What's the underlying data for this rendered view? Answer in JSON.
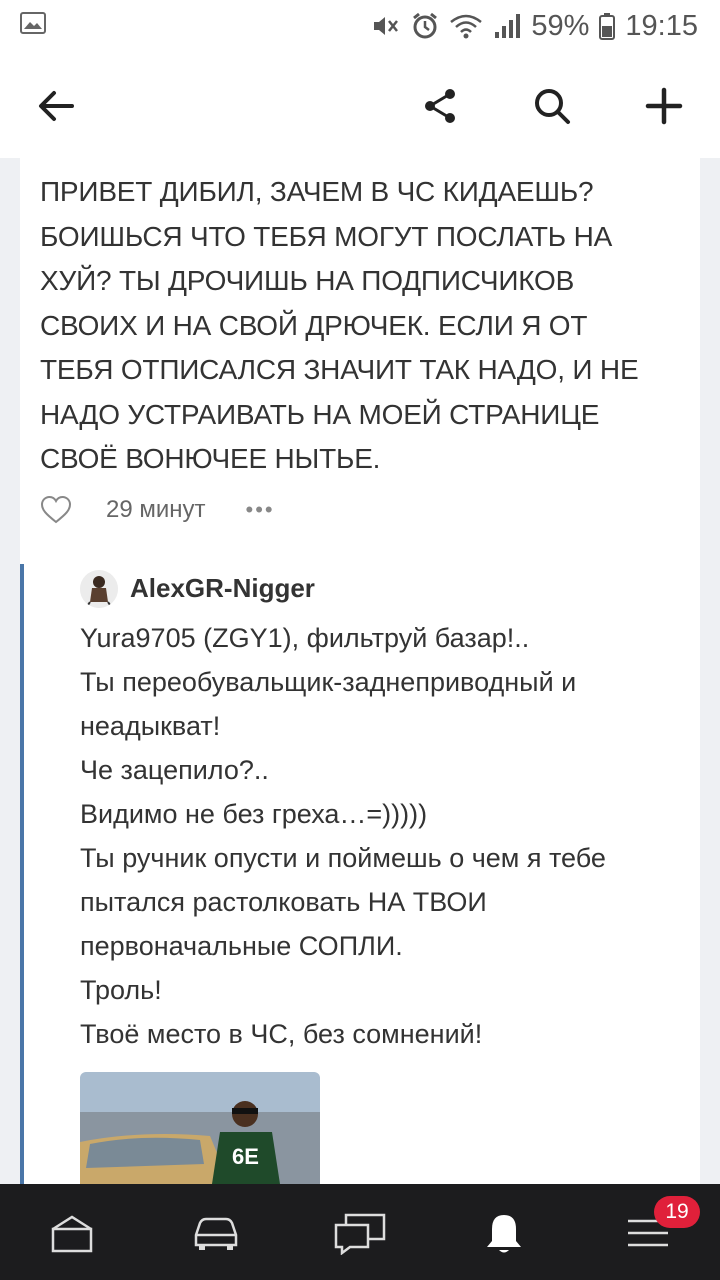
{
  "status_bar": {
    "battery": "59%",
    "time": "19:15"
  },
  "post": {
    "lines": [
      "ПРИВЕТ ДИБИЛ, ЗАЧЕМ В ЧС КИДАЕШЬ?",
      "БОИШЬСЯ ЧТО ТЕБЯ МОГУТ ПОСЛАТЬ НА",
      "ХУЙ? ТЫ ДРОЧИШЬ НА ПОДПИСЧИКОВ",
      "СВОИХ И НА СВОЙ ДРЮЧЕК. ЕСЛИ Я ОТ",
      "ТЕБЯ ОТПИСАЛСЯ ЗНАЧИТ ТАК НАДО, И НЕ",
      "НАДО УСТРАИВАТЬ НА МОЕЙ СТРАНИЦЕ",
      "СВОЁ ВОНЮЧЕЕ НЫТЬЕ."
    ],
    "time": "29 минут",
    "more": "•••"
  },
  "reply": {
    "author": "AlexGR-Nigger",
    "lines": [
      "Yura9705 (ZGY1), фильтруй базар!..",
      "Ты переобувальщик-заднеприводный и",
      "неадыкват!",
      "Че зацепило?..",
      "Видимо не без греха…=)))))",
      "Ты ручник опусти и поймешь о чем я тебе",
      "пытался растолковать НА ТВОИ",
      "первоначальные СОПЛИ.",
      "Троль!",
      "Твоё место в ЧС, без сомнений!"
    ]
  },
  "tabbar": {
    "items": [
      "home-icon",
      "car-icon",
      "messages-icon",
      "bell-icon",
      "menu-icon"
    ],
    "badge": "19"
  },
  "colors": {
    "accent": "#4a76a8",
    "badge": "#e0203a",
    "tabbar": "#1c1c1e",
    "background": "#eef0f3"
  }
}
